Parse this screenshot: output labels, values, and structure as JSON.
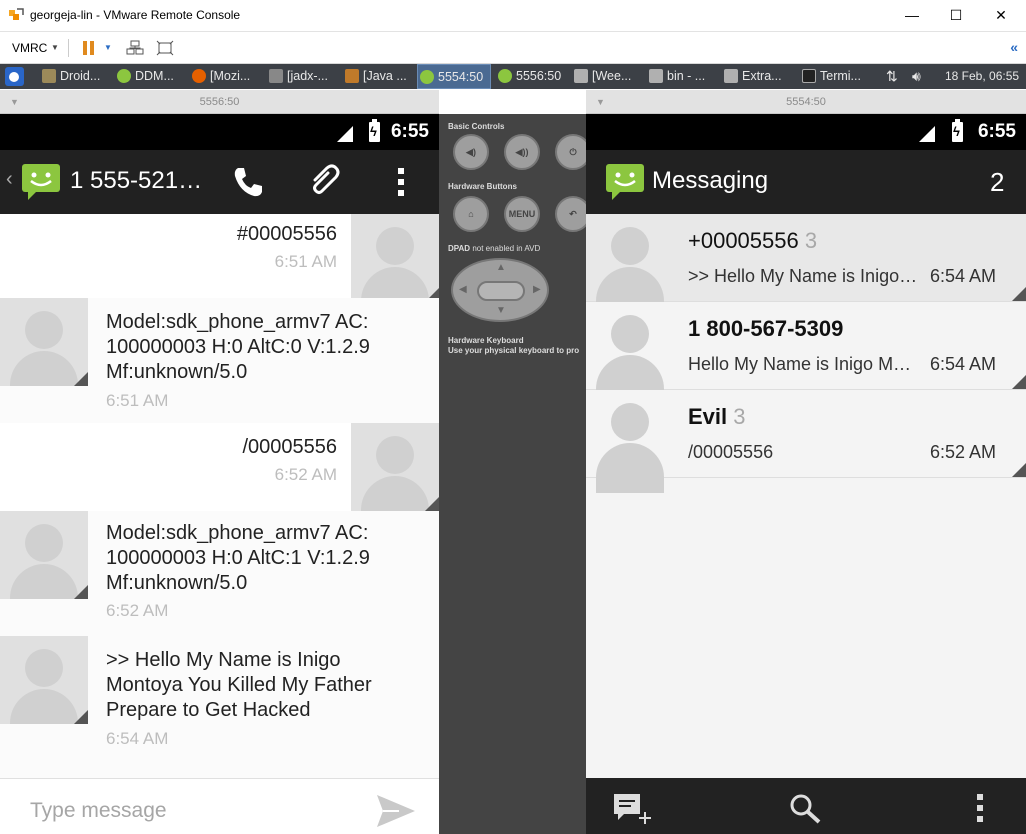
{
  "window": {
    "title": "georgeja-lin - VMware Remote Console",
    "minimize": "—",
    "maximize": "☐",
    "close": "✕"
  },
  "toolbar": {
    "vmrc_label": "VMRC",
    "expand_label": "«"
  },
  "taskbar": {
    "tasks": [
      {
        "label": "Droid...",
        "color": "#9c8a5a"
      },
      {
        "label": "DDM...",
        "color": "#8cc63f"
      },
      {
        "label": "[Mozi...",
        "color": "#e66000"
      },
      {
        "label": "[jadx-...",
        "color": "#888888"
      },
      {
        "label": "[Java ...",
        "color": "#c07a2a"
      },
      {
        "label": "5554:50",
        "color": "#8cc63f"
      },
      {
        "label": "5556:50",
        "color": "#8cc63f"
      },
      {
        "label": "[Wee...",
        "color": "#b0b0b0"
      },
      {
        "label": "bin - ...",
        "color": "#b0b0b0"
      },
      {
        "label": "Extra...",
        "color": "#b0b0b0"
      },
      {
        "label": "Termi...",
        "color": "#222222"
      }
    ],
    "datetime": "18 Feb, 06:55"
  },
  "left_emulator": {
    "window_label": "5556:50",
    "clock": "6:55",
    "contact": "1 555-521…",
    "messages": [
      {
        "dir": "out",
        "text": [
          "#00005556"
        ],
        "time": "6:51 AM"
      },
      {
        "dir": "in",
        "text": [
          "Model:sdk_phone_armv7 AC:",
          "100000003 H:0 AltC:0 V:1.2.9",
          "Mf:unknown/5.0"
        ],
        "time": "6:51 AM"
      },
      {
        "dir": "out",
        "text": [
          "/00005556"
        ],
        "time": "6:52 AM"
      },
      {
        "dir": "in",
        "text": [
          "Model:sdk_phone_armv7 AC:",
          "100000003 H:0 AltC:1 V:1.2.9",
          "Mf:unknown/5.0"
        ],
        "time": "6:52 AM"
      },
      {
        "dir": "in",
        "text": [
          ">> Hello My Name is Inigo",
          "Montoya You Killed My Father",
          "Prepare to Get Hacked"
        ],
        "time": "6:54 AM"
      }
    ],
    "compose_placeholder": "Type message"
  },
  "controls": {
    "basic_label": "Basic Controls",
    "hardware_label": "Hardware Buttons",
    "menu_label": "MENU",
    "dpad_label": "DPAD",
    "dpad_note": "not enabled in AVD",
    "keyboard_label": "Hardware Keyboard",
    "keyboard_note": "Use your physical keyboard to pro"
  },
  "right_emulator": {
    "window_label": "5554:50",
    "clock": "6:55",
    "title": "Messaging",
    "unread_count": "2",
    "conversations": [
      {
        "name": "+00005556",
        "count": "3",
        "snippet": ">> Hello My Name is Inigo…",
        "time": "6:54 AM",
        "unread": true,
        "bold": false
      },
      {
        "name": "1 800-567-5309",
        "count": "",
        "snippet": "Hello My Name is Inigo M…",
        "time": "6:54 AM",
        "unread": false,
        "bold": true
      },
      {
        "name": "Evil",
        "count": "3",
        "snippet": "/00005556",
        "time": "6:52 AM",
        "unread": false,
        "bold": true
      }
    ]
  }
}
